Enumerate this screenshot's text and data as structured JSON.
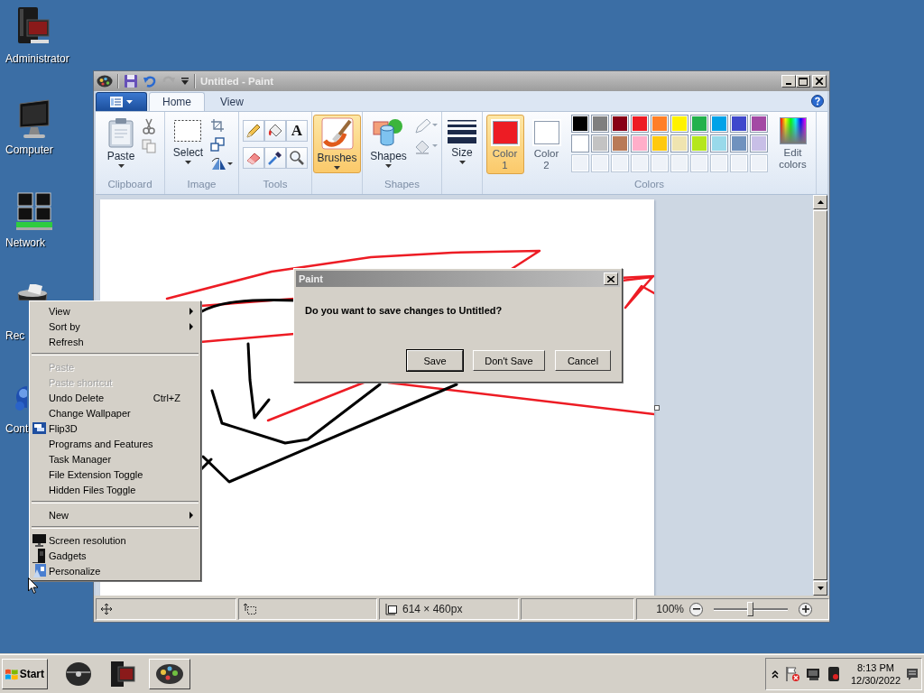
{
  "desktop_icons": [
    {
      "label": "Administrator"
    },
    {
      "label": "Computer"
    },
    {
      "label": "Network"
    },
    {
      "label": "Rec"
    },
    {
      "label": "Cont"
    }
  ],
  "paint_window": {
    "title": "Untitled - Paint",
    "tabs": [
      {
        "label": "Home",
        "selected": true
      },
      {
        "label": "View",
        "selected": false
      }
    ],
    "ribbon": [
      {
        "kind": "clipboard",
        "label": "Clipboard",
        "button": "Paste"
      },
      {
        "kind": "image",
        "label": "Image",
        "button": "Select"
      },
      {
        "kind": "tools",
        "label": "Tools",
        "text_tool": "A"
      },
      {
        "kind": "brushes",
        "button": "Brushes",
        "selected": true
      },
      {
        "kind": "shapes",
        "label": "Shapes",
        "button": "Shapes"
      },
      {
        "kind": "size",
        "button": "Size"
      },
      {
        "kind": "colors",
        "label": "Colors",
        "edit_button": "Edit colors",
        "color_buttons": [
          {
            "label": "Color 1",
            "color": "#ed1c24",
            "selected": true
          },
          {
            "label": "Color 2",
            "color": "#ffffff",
            "selected": false
          }
        ],
        "palette": [
          {
            "color": "#000000"
          },
          {
            "color": "#7f7f7f"
          },
          {
            "color": "#880015"
          },
          {
            "color": "#ed1c24"
          },
          {
            "color": "#ff7f27"
          },
          {
            "color": "#fff200"
          },
          {
            "color": "#22b14c"
          },
          {
            "color": "#00a2e8"
          },
          {
            "color": "#3f48cc"
          },
          {
            "color": "#a349a4"
          },
          {
            "color": "#ffffff"
          },
          {
            "color": "#c3c3c3"
          },
          {
            "color": "#b97a57"
          },
          {
            "color": "#ffaec9"
          },
          {
            "color": "#ffc90e"
          },
          {
            "color": "#efe4b0"
          },
          {
            "color": "#b5e61d"
          },
          {
            "color": "#99d9ea"
          },
          {
            "color": "#7092be"
          },
          {
            "color": "#c8bfe7"
          }
        ]
      }
    ],
    "status_bar": {
      "image_size": "614 × 460px",
      "zoom": "100%",
      "zoom_slider": {
        "level": 0.5
      }
    }
  },
  "context_menu": {
    "items": [
      {
        "kind": "item",
        "label": "View",
        "submenu": true,
        "disabled": false
      },
      {
        "kind": "item",
        "label": "Sort by",
        "submenu": true,
        "disabled": false
      },
      {
        "kind": "item",
        "label": "Refresh",
        "submenu": false,
        "disabled": false
      },
      {
        "kind": "separator"
      },
      {
        "kind": "item",
        "label": "Paste",
        "submenu": false,
        "disabled": true
      },
      {
        "kind": "item",
        "label": "Paste shortcut",
        "submenu": false,
        "disabled": true
      },
      {
        "kind": "item",
        "label": "Undo Delete",
        "shortcut": "Ctrl+Z",
        "submenu": false,
        "disabled": false
      },
      {
        "kind": "item",
        "label": "Change Wallpaper",
        "submenu": false,
        "disabled": false
      },
      {
        "kind": "item",
        "label": "Flip3D",
        "submenu": false,
        "disabled": false
      },
      {
        "kind": "item",
        "label": "Programs and Features",
        "submenu": false,
        "disabled": false
      },
      {
        "kind": "item",
        "label": "Task Manager",
        "submenu": false,
        "disabled": false
      },
      {
        "kind": "item",
        "label": "File Extension Toggle",
        "submenu": false,
        "disabled": false
      },
      {
        "kind": "item",
        "label": "Hidden Files Toggle",
        "submenu": false,
        "disabled": false
      },
      {
        "kind": "separator"
      },
      {
        "kind": "item",
        "label": "New",
        "submenu": true,
        "disabled": false
      },
      {
        "kind": "separator"
      },
      {
        "kind": "item",
        "label": "Screen resolution",
        "submenu": false,
        "disabled": false
      },
      {
        "kind": "item",
        "label": "Gadgets",
        "submenu": false,
        "disabled": false
      },
      {
        "kind": "item",
        "label": "Personalize",
        "submenu": false,
        "disabled": false
      }
    ]
  },
  "dialog": {
    "title": "Paint",
    "message": "Do you want to save changes to Untitled?",
    "buttons": [
      {
        "label": "Save",
        "default": true
      },
      {
        "label": "Don't Save",
        "default": false
      },
      {
        "label": "Cancel",
        "default": false
      }
    ]
  },
  "taskbar": {
    "start": "Start",
    "clock": {
      "time": "8:13 PM",
      "date": "12/30/2022"
    }
  }
}
